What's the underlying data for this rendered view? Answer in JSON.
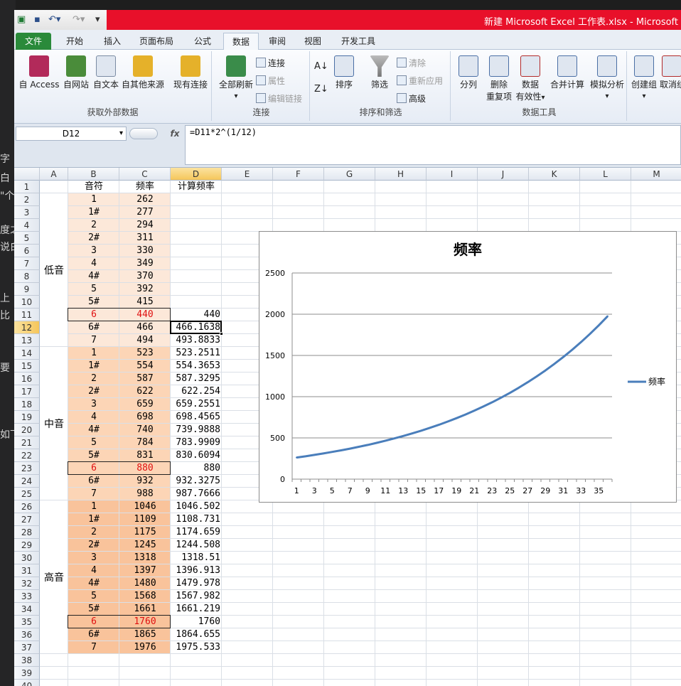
{
  "window": {
    "title": "新建 Microsoft Excel 工作表.xlsx - Microsoft"
  },
  "background_editor_chars": [
    "字",
    "白",
    "\"个",
    "度之",
    "说白",
    "上",
    "比",
    "要",
    "如下"
  ],
  "tabs": [
    {
      "label": "文件",
      "kind": "file"
    },
    {
      "label": "开始"
    },
    {
      "label": "插入"
    },
    {
      "label": "页面布局"
    },
    {
      "label": "公式"
    },
    {
      "label": "数据",
      "active": true
    },
    {
      "label": "审阅"
    },
    {
      "label": "视图"
    },
    {
      "label": "开发工具"
    }
  ],
  "ribbon": {
    "groups": {
      "external": {
        "label": "获取外部数据",
        "buttons": [
          "自 Access",
          "自网站",
          "自文本",
          "自其他来源",
          "现有连接"
        ]
      },
      "connections": {
        "label": "连接",
        "refresh": "全部刷新",
        "small": [
          "连接",
          "属性",
          "编辑链接"
        ]
      },
      "sort": {
        "label": "排序和筛选",
        "sort": "排序",
        "filter": "筛选",
        "small": [
          "清除",
          "重新应用",
          "高级"
        ]
      },
      "tools": {
        "label": "数据工具",
        "split": "分列",
        "remove_dup_1": "删除",
        "remove_dup_2": "重复项",
        "validation_1": "数据",
        "validation_2": "有效性",
        "consolidate": "合并计算",
        "whatif": "模拟分析"
      },
      "outline": {
        "group": "创建组",
        "ungroup": "取消组"
      }
    }
  },
  "formula_bar": {
    "name_box": "D12",
    "fx": "fx",
    "formula": "=D11*2^(1/12)"
  },
  "sheet": {
    "columns": [
      "A",
      "B",
      "C",
      "D",
      "E",
      "F",
      "G",
      "H",
      "I",
      "J",
      "K",
      "L",
      "M"
    ],
    "header_row": {
      "B": "音符",
      "C": "频率",
      "D": "计算频率"
    },
    "groups": [
      {
        "label": "低音",
        "start_row": 2,
        "end_row": 13
      },
      {
        "label": "中音",
        "start_row": 14,
        "end_row": 25
      },
      {
        "label": "高音",
        "start_row": 26,
        "end_row": 37
      }
    ],
    "rows": [
      {
        "r": 2,
        "note": "1",
        "freq": "262",
        "calc": ""
      },
      {
        "r": 3,
        "note": "1#",
        "freq": "277",
        "calc": ""
      },
      {
        "r": 4,
        "note": "2",
        "freq": "294",
        "calc": ""
      },
      {
        "r": 5,
        "note": "2#",
        "freq": "311",
        "calc": ""
      },
      {
        "r": 6,
        "note": "3",
        "freq": "330",
        "calc": ""
      },
      {
        "r": 7,
        "note": "4",
        "freq": "349",
        "calc": ""
      },
      {
        "r": 8,
        "note": "4#",
        "freq": "370",
        "calc": ""
      },
      {
        "r": 9,
        "note": "5",
        "freq": "392",
        "calc": ""
      },
      {
        "r": 10,
        "note": "5#",
        "freq": "415",
        "calc": ""
      },
      {
        "r": 11,
        "note": "6",
        "freq": "440",
        "calc": "440",
        "highlight": true
      },
      {
        "r": 12,
        "note": "6#",
        "freq": "466",
        "calc": "466.1638"
      },
      {
        "r": 13,
        "note": "7",
        "freq": "494",
        "calc": "493.8833"
      },
      {
        "r": 14,
        "note": "1",
        "freq": "523",
        "calc": "523.2511"
      },
      {
        "r": 15,
        "note": "1#",
        "freq": "554",
        "calc": "554.3653"
      },
      {
        "r": 16,
        "note": "2",
        "freq": "587",
        "calc": "587.3295"
      },
      {
        "r": 17,
        "note": "2#",
        "freq": "622",
        "calc": "622.254"
      },
      {
        "r": 18,
        "note": "3",
        "freq": "659",
        "calc": "659.2551"
      },
      {
        "r": 19,
        "note": "4",
        "freq": "698",
        "calc": "698.4565"
      },
      {
        "r": 20,
        "note": "4#",
        "freq": "740",
        "calc": "739.9888"
      },
      {
        "r": 21,
        "note": "5",
        "freq": "784",
        "calc": "783.9909"
      },
      {
        "r": 22,
        "note": "5#",
        "freq": "831",
        "calc": "830.6094"
      },
      {
        "r": 23,
        "note": "6",
        "freq": "880",
        "calc": "880",
        "highlight": true
      },
      {
        "r": 24,
        "note": "6#",
        "freq": "932",
        "calc": "932.3275"
      },
      {
        "r": 25,
        "note": "7",
        "freq": "988",
        "calc": "987.7666"
      },
      {
        "r": 26,
        "note": "1",
        "freq": "1046",
        "calc": "1046.502"
      },
      {
        "r": 27,
        "note": "1#",
        "freq": "1109",
        "calc": "1108.731"
      },
      {
        "r": 28,
        "note": "2",
        "freq": "1175",
        "calc": "1174.659"
      },
      {
        "r": 29,
        "note": "2#",
        "freq": "1245",
        "calc": "1244.508"
      },
      {
        "r": 30,
        "note": "3",
        "freq": "1318",
        "calc": "1318.51"
      },
      {
        "r": 31,
        "note": "4",
        "freq": "1397",
        "calc": "1396.913"
      },
      {
        "r": 32,
        "note": "4#",
        "freq": "1480",
        "calc": "1479.978"
      },
      {
        "r": 33,
        "note": "5",
        "freq": "1568",
        "calc": "1567.982"
      },
      {
        "r": 34,
        "note": "5#",
        "freq": "1661",
        "calc": "1661.219"
      },
      {
        "r": 35,
        "note": "6",
        "freq": "1760",
        "calc": "1760",
        "highlight": true
      },
      {
        "r": 36,
        "note": "6#",
        "freq": "1865",
        "calc": "1864.655"
      },
      {
        "r": 37,
        "note": "7",
        "freq": "1976",
        "calc": "1975.533"
      }
    ],
    "visible_rows": 40,
    "active_cell": {
      "col": "D",
      "row": 12
    }
  },
  "colors": {
    "accent_file_tab": "#2a8a3a",
    "title_red": "#e8102a",
    "low_fill": "#fce8d9",
    "mid_fill": "#fcd5b6",
    "high_fill": "#f9c39b",
    "series_line": "#4a7ebb",
    "highlight_text": "#e01010"
  },
  "chart_data": {
    "type": "line",
    "title": "频率",
    "legend": "right",
    "grid": true,
    "ylim": [
      0,
      2500
    ],
    "yticks": [
      0,
      500,
      1000,
      1500,
      2000,
      2500
    ],
    "xtick_labels": [
      "1",
      "3",
      "5",
      "7",
      "9",
      "11",
      "13",
      "15",
      "17",
      "19",
      "21",
      "23",
      "25",
      "27",
      "29",
      "31",
      "33",
      "35"
    ],
    "series": [
      {
        "name": "频率",
        "values": [
          262,
          277,
          294,
          311,
          330,
          349,
          370,
          392,
          415,
          440,
          466,
          494,
          523,
          554,
          587,
          622,
          659,
          698,
          740,
          784,
          831,
          880,
          932,
          988,
          1046,
          1109,
          1175,
          1245,
          1318,
          1397,
          1480,
          1568,
          1661,
          1760,
          1865,
          1976
        ]
      }
    ]
  }
}
